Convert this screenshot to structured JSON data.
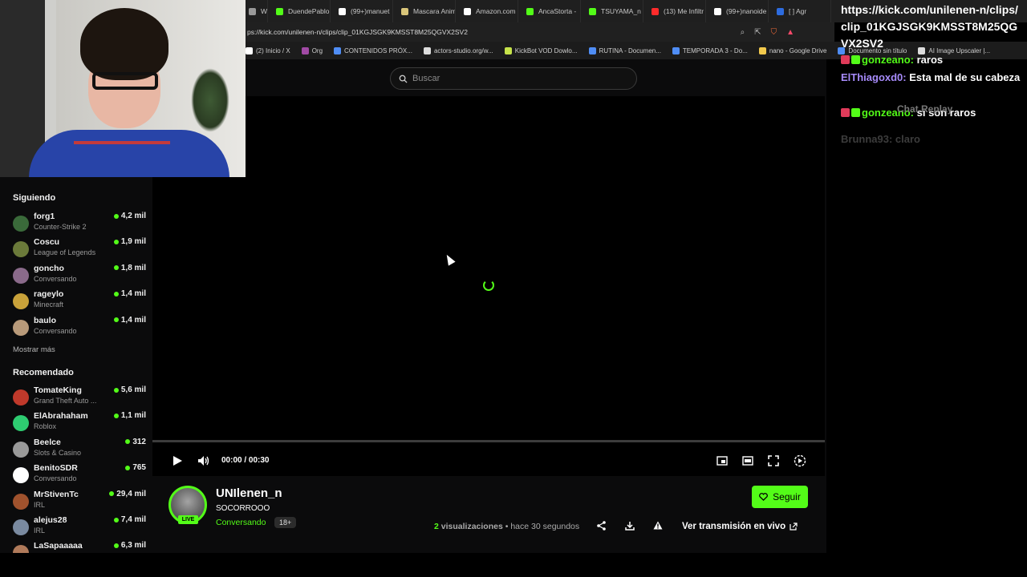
{
  "browser": {
    "tabs": [
      {
        "label": "W",
        "color": "#999999"
      },
      {
        "label": "DuendePablo",
        "color": "#53fc18"
      },
      {
        "label": "(99+)manuet",
        "color": "#ffffff"
      },
      {
        "label": "Mascara Anim",
        "color": "#d9c57a"
      },
      {
        "label": "Amazon.com",
        "color": "#ffffff"
      },
      {
        "label": "AncaStorta -",
        "color": "#53fc18"
      },
      {
        "label": "TSUYAMA_n",
        "color": "#53fc18"
      },
      {
        "label": "(13) Me Infiltr",
        "color": "#ff2b2b"
      },
      {
        "label": "(99+)nanoide",
        "color": "#ffffff"
      },
      {
        "label": "[ ] Agr",
        "color": "#2d6cdf"
      }
    ],
    "url": "ps://kick.com/unilenen-n/clips/clip_01KGJSGK9KMSST8M25QGVX2SV2",
    "bookmarks": [
      {
        "label": "(2) Inicio / X",
        "color": "#ffffff"
      },
      {
        "label": "Org",
        "color": "#a14aa5"
      },
      {
        "label": "CONTENIDOS PRÓX...",
        "color": "#4f8df5"
      },
      {
        "label": "actors-studio.org/w...",
        "color": "#dddddd"
      },
      {
        "label": "KickBot VOD Dowlo...",
        "color": "#c6e34a"
      },
      {
        "label": "RUTINA - Documen...",
        "color": "#4f8df5"
      },
      {
        "label": "TEMPORADA 3 - Do...",
        "color": "#4f8df5"
      },
      {
        "label": "nano - Google Drive",
        "color": "#f2c94c"
      },
      {
        "label": "Documento sin título",
        "color": "#4f8df5"
      },
      {
        "label": "AI Image Upscaler |...",
        "color": "#dddddd"
      }
    ]
  },
  "search": {
    "placeholder": "Buscar"
  },
  "sidebar": {
    "following_title": "Siguiendo",
    "following": [
      {
        "name": "forg1",
        "category": "Counter-Strike 2",
        "viewers": "4,2 mil",
        "avatar": "#3a6a3a"
      },
      {
        "name": "Coscu",
        "category": "League of Legends",
        "viewers": "1,9 mil",
        "avatar": "#6b7a3a"
      },
      {
        "name": "goncho",
        "category": "Conversando",
        "viewers": "1,8 mil",
        "avatar": "#8a6a8a"
      },
      {
        "name": "rageylo",
        "category": "Minecraft",
        "viewers": "1,4 mil",
        "avatar": "#c9a23a"
      },
      {
        "name": "baulo",
        "category": "Conversando",
        "viewers": "1,4 mil",
        "avatar": "#b89a7a"
      }
    ],
    "show_more": "Mostrar más",
    "recommended_title": "Recomendado",
    "recommended": [
      {
        "name": "TomateKing",
        "category": "Grand Theft Auto ...",
        "viewers": "5,6 mil",
        "avatar": "#c0392b"
      },
      {
        "name": "ElAbrahaham",
        "category": "Roblox",
        "viewers": "1,1 mil",
        "avatar": "#2ecc71"
      },
      {
        "name": "Beelce",
        "category": "Slots & Casino",
        "viewers": "312",
        "avatar": "#9a9a9a"
      },
      {
        "name": "BenitoSDR",
        "category": "Conversando",
        "viewers": "765",
        "avatar": "#ffffff"
      },
      {
        "name": "MrStivenTc",
        "category": "IRL",
        "viewers": "29,4 mil",
        "avatar": "#a0522d"
      },
      {
        "name": "alejus28",
        "category": "IRL",
        "viewers": "7,4 mil",
        "avatar": "#7a8aa0"
      },
      {
        "name": "LaSapaaaaa",
        "category": "",
        "viewers": "6,3 mil",
        "avatar": "#b07a5a"
      }
    ]
  },
  "player": {
    "time": "00:00 / 00:30",
    "progress": 0
  },
  "clip": {
    "streamer": "UNIlenen_n",
    "title": "SOCORROOO",
    "category": "Conversando",
    "age": "18+",
    "live_badge": "LIVE",
    "follow_label": "Seguir",
    "views_count": "2",
    "views_label": " visualizaciones",
    "time_ago": " • hace 30 segundos",
    "watch_live": "Ver transmisión en vivo"
  },
  "chat_overlay": {
    "url_text": "https://kick.com/unilenen-n/clips/clip_01KGJSGK9KMSST8M25QGVX2SV2",
    "messages": [
      {
        "user": "gonzeano",
        "text": " raros",
        "user_color": "#53fc18"
      },
      {
        "user": "ElThiagoxd0",
        "text": " Esta mal de su cabeza",
        "user_color": "#a78bfa"
      },
      {
        "user": "gonzeano",
        "text": " si son raros",
        "user_color": "#53fc18"
      }
    ],
    "chat_replay": "Chat Replay",
    "ghost": "Brunna93: claro"
  },
  "colors": {
    "accent": "#53fc18",
    "background": "#0b0b0c"
  }
}
